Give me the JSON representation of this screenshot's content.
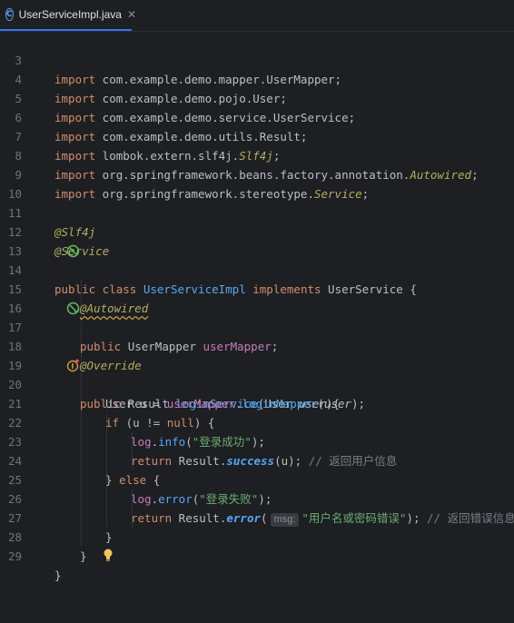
{
  "tab": {
    "label": "UserServiceImpl.java",
    "icon_letter": "C",
    "close": "✕"
  },
  "lines": {
    "3": {
      "num": "3",
      "a": "import",
      "b": " com.example.demo.mapper.UserMapper;"
    },
    "4": {
      "num": "4",
      "a": "import",
      "b": " com.example.demo.pojo.User;"
    },
    "5": {
      "num": "5",
      "a": "import",
      "b": " com.example.demo.service.UserService;"
    },
    "6": {
      "num": "6",
      "a": "import",
      "b": " com.example.demo.utils.Result;"
    },
    "7": {
      "num": "7",
      "a": "import",
      "b": " lombok.extern.slf4j.",
      "c": "Slf4j",
      "d": ";"
    },
    "8": {
      "num": "8",
      "a": "import",
      "b": " org.springframework.beans.factory.annotation.",
      "c": "Autowired",
      "d": ";"
    },
    "9": {
      "num": "9",
      "a": "import",
      "b": " org.springframework.stereotype.",
      "c": "Service",
      "d": ";"
    },
    "10": {
      "num": "10"
    },
    "11": {
      "num": "11",
      "a": "@Slf4j"
    },
    "12": {
      "num": "12",
      "a": "@Service"
    },
    "13": {
      "num": "13",
      "a": "public class ",
      "b": "UserServiceImpl",
      "c": " implements ",
      "d": "UserService",
      "e": " {"
    },
    "14": {
      "num": "14"
    },
    "15": {
      "num": "15",
      "a": "@Autowired"
    },
    "16": {
      "num": "16",
      "a": "public ",
      "b": "UserMapper ",
      "c": "userMapper",
      "d": ";"
    },
    "17": {
      "num": "17"
    },
    "18": {
      "num": "18",
      "a": "@Override"
    },
    "19": {
      "num": "19",
      "a": "public ",
      "b": "Result ",
      "c": "loginService",
      "d": "(User ",
      "e": "user",
      "f": "){"
    },
    "20": {
      "num": "20",
      "a": "User u = ",
      "b": "userMapper",
      "c": ".",
      "d": "loginMapper",
      "e": "(",
      "f": "user",
      "g": ");"
    },
    "21": {
      "num": "21",
      "a": "if",
      "b": " (u != ",
      "c": "null",
      "d": ") {"
    },
    "22": {
      "num": "22",
      "a": "log",
      "b": ".",
      "c": "info",
      "d": "(",
      "e": "\"登录成功\"",
      "f": ");"
    },
    "23": {
      "num": "23",
      "a": "return",
      "b": " Result.",
      "c": "success",
      "d": "(u); ",
      "e": "// 返回用户信息"
    },
    "24": {
      "num": "24",
      "a": "} ",
      "b": "else",
      "c": " {"
    },
    "25": {
      "num": "25",
      "a": "log",
      "b": ".",
      "c": "error",
      "d": "(",
      "e": "\"登录失败\"",
      "f": ");"
    },
    "26": {
      "num": "26",
      "a": "return",
      "b": " Result.",
      "c": "error",
      "d": "(",
      "hint": "msg:",
      "e": "\"用户名或密码错误\"",
      "f": "); ",
      "g": "// 返回错误信息"
    },
    "27": {
      "num": "27",
      "a": "}"
    },
    "28": {
      "num": "28",
      "a": "}"
    },
    "29": {
      "num": "29",
      "a": "}"
    }
  },
  "colors": {
    "keyword": "#cf8e6d",
    "annotation": "#b3ae60",
    "string": "#6aab73",
    "method": "#56a8f5",
    "field": "#c77dbb",
    "comment": "#7a7e85",
    "text": "#bcbec4"
  },
  "gutter_icons": {
    "13": "implementation-icon",
    "16": "bean-injection-icon",
    "19": "override-icon",
    "29": "lightbulb-icon"
  }
}
